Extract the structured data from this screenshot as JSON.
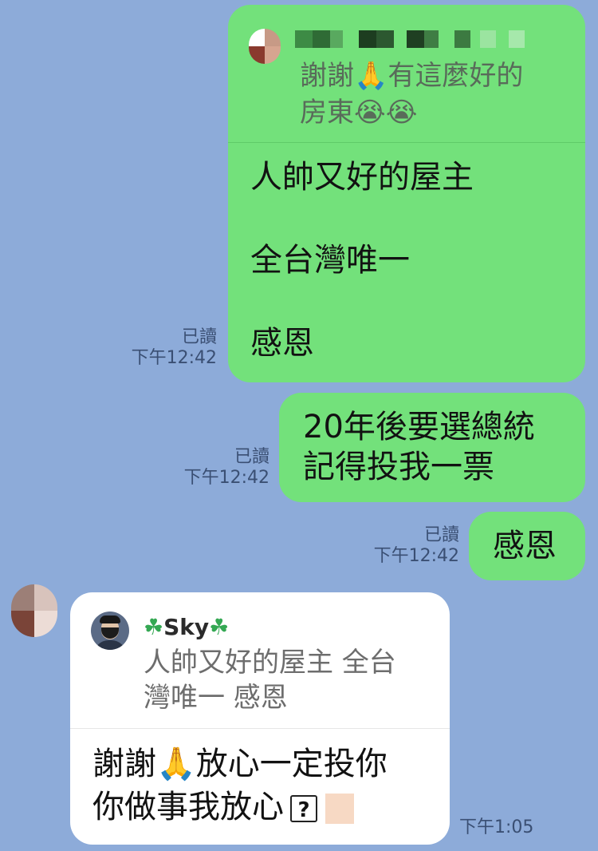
{
  "colors": {
    "background": "#8dabd9",
    "outgoing_bubble": "#73e17b",
    "incoming_bubble": "#ffffff",
    "meta_text": "#3a4f73"
  },
  "messages": [
    {
      "id": "msg1",
      "direction": "outgoing",
      "reply_quote": {
        "text_line1": "謝謝🙏有這麼好的",
        "text_line2": "房東😭😭"
      },
      "lines": [
        "人帥又好的屋主",
        "",
        "全台灣唯一",
        "",
        "感恩"
      ],
      "read_label": "已讀",
      "time": "下午12:42"
    },
    {
      "id": "msg2",
      "direction": "outgoing",
      "lines": [
        "20年後要選總統",
        "記得投我一票"
      ],
      "read_label": "已讀",
      "time": "下午12:42"
    },
    {
      "id": "msg3",
      "direction": "outgoing",
      "lines": [
        "感恩"
      ],
      "read_label": "已讀",
      "time": "下午12:42"
    },
    {
      "id": "msg4",
      "direction": "incoming",
      "reply_quote": {
        "sender_name_prefix": "☘",
        "sender_name": "Sky",
        "sender_name_suffix": "☘",
        "text_line1": "人帥又好的屋主 全台",
        "text_line2": "灣唯一 感恩"
      },
      "line1": "謝謝🙏放心一定投你",
      "line2": "你做事我放心",
      "unknown_glyph": "?",
      "time": "下午1:05"
    }
  ]
}
